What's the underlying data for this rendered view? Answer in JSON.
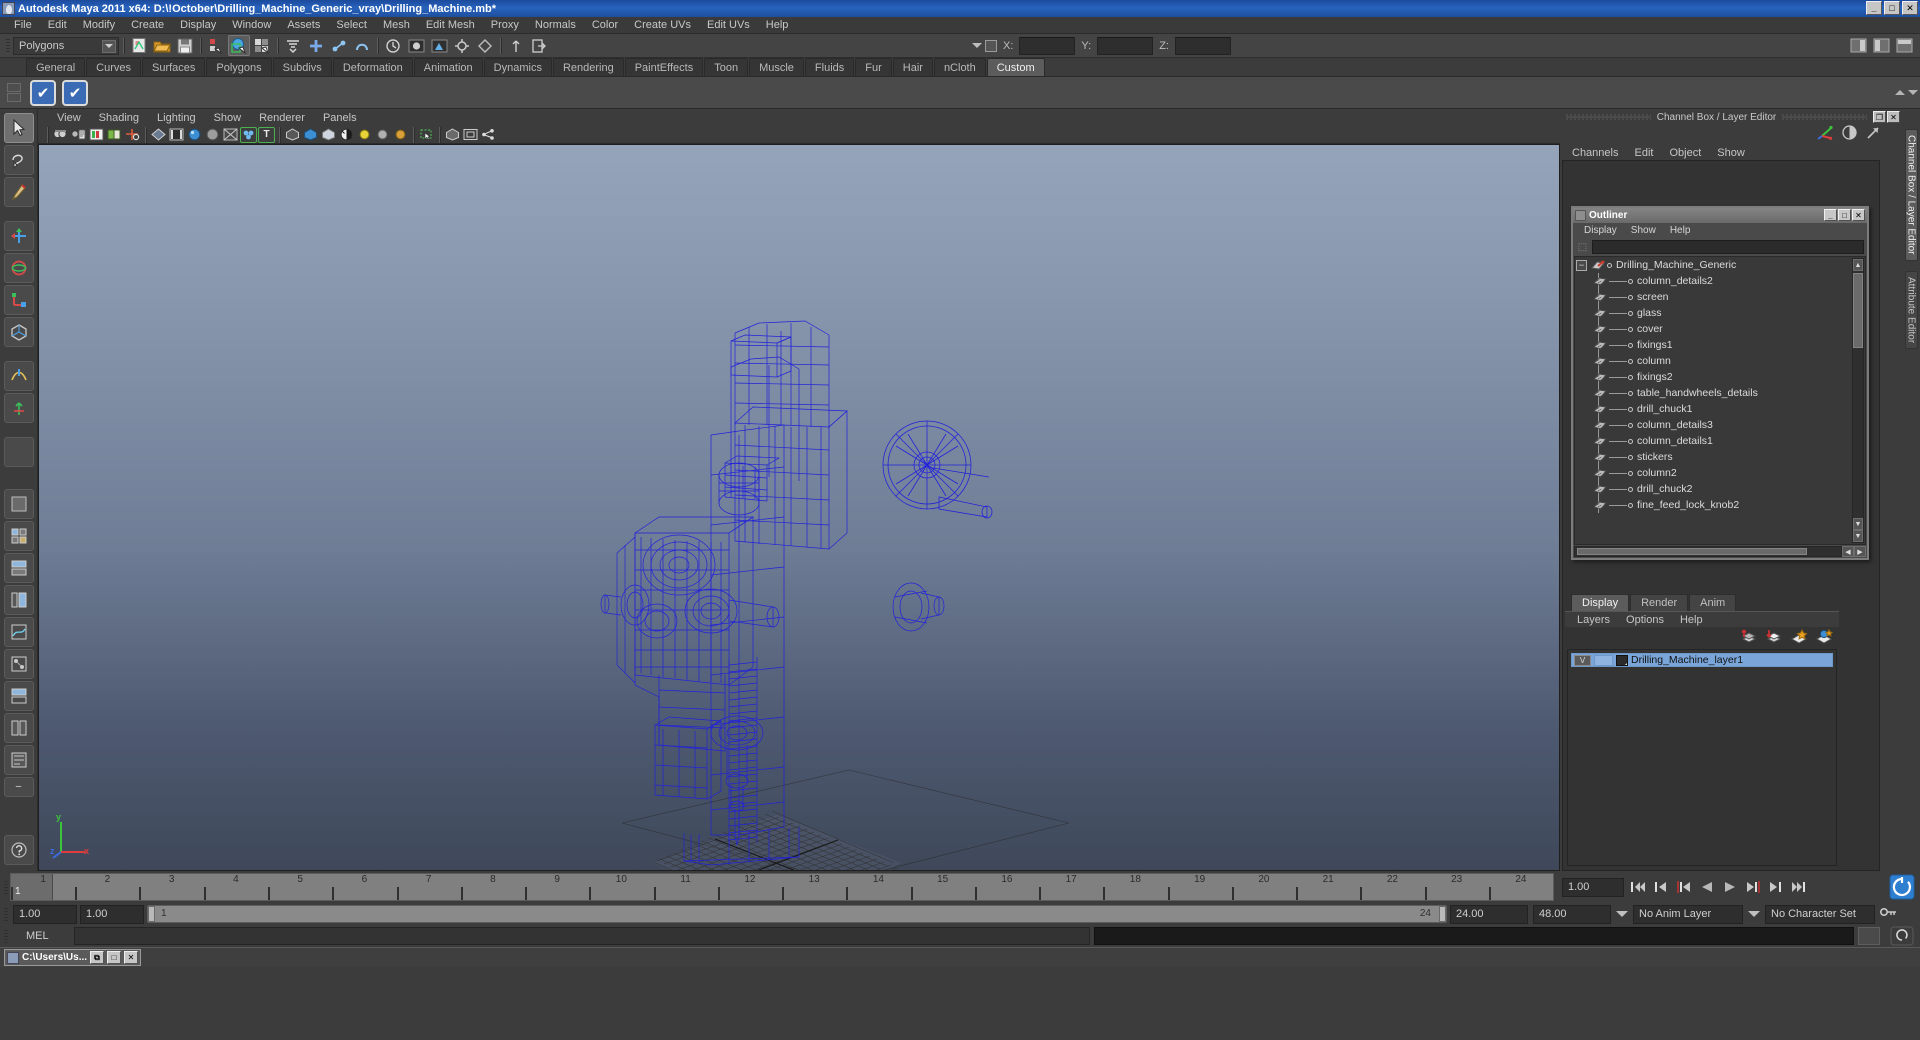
{
  "window": {
    "title": "Autodesk Maya 2011 x64: D:\\!October\\Drilling_Machine_Generic_vray\\Drilling_Machine.mb*",
    "minimize": "_",
    "maximize": "□",
    "close": "✕"
  },
  "menubar": {
    "items": [
      "File",
      "Edit",
      "Modify",
      "Create",
      "Display",
      "Window",
      "Assets",
      "Select",
      "Mesh",
      "Edit Mesh",
      "Proxy",
      "Normals",
      "Color",
      "Create UVs",
      "Edit UVs",
      "Help"
    ]
  },
  "statusline": {
    "mode_selected": "Polygons",
    "axis_labels": {
      "x": "X:",
      "y": "Y:",
      "z": "Z:"
    },
    "x_value": "",
    "y_value": "",
    "z_value": ""
  },
  "shelf": {
    "tabs": [
      "General",
      "Curves",
      "Surfaces",
      "Polygons",
      "Subdivs",
      "Deformation",
      "Animation",
      "Dynamics",
      "Rendering",
      "PaintEffects",
      "Toon",
      "Muscle",
      "Fluids",
      "Fur",
      "Hair",
      "nCloth",
      "Custom"
    ],
    "active_tab": "Custom",
    "icons": [
      "check-blue-icon",
      "check-blue-icon"
    ]
  },
  "viewport": {
    "menus": [
      "View",
      "Shading",
      "Lighting",
      "Show",
      "Renderer",
      "Panels"
    ],
    "axis": {
      "y": "y",
      "x": "x",
      "z": "z"
    },
    "model_name": "Drilling_Machine_Generic",
    "wireframe_color": "#2020d8",
    "background_top": "#96a4bb",
    "background_bottom": "#3e4859"
  },
  "channelbox": {
    "title": "Channel Box / Layer Editor",
    "menus": [
      "Channels",
      "Edit",
      "Object",
      "Show"
    ],
    "restore": "❐",
    "close": "✕"
  },
  "vertical_tabs": [
    {
      "label": "Channel Box / Layer Editor",
      "active": true
    },
    {
      "label": "Attribute Editor",
      "active": false
    }
  ],
  "outliner": {
    "title": "Outliner",
    "menus": [
      "Display",
      "Show",
      "Help"
    ],
    "search_value": "",
    "minimize": "_",
    "maximize": "□",
    "close": "✕",
    "root": {
      "label": "Drilling_Machine_Generic",
      "expander": "−",
      "icon": "transform-icon"
    },
    "children": [
      {
        "label": "column_details2",
        "icon": "mesh-icon"
      },
      {
        "label": "screen",
        "icon": "mesh-icon"
      },
      {
        "label": "glass",
        "icon": "mesh-icon"
      },
      {
        "label": "cover",
        "icon": "mesh-icon"
      },
      {
        "label": "fixings1",
        "icon": "mesh-icon"
      },
      {
        "label": "column",
        "icon": "mesh-icon"
      },
      {
        "label": "fixings2",
        "icon": "mesh-icon"
      },
      {
        "label": "table_handwheels_details",
        "icon": "mesh-icon"
      },
      {
        "label": "drill_chuck1",
        "icon": "mesh-icon"
      },
      {
        "label": "column_details3",
        "icon": "mesh-icon"
      },
      {
        "label": "column_details1",
        "icon": "mesh-icon"
      },
      {
        "label": "stickers",
        "icon": "mesh-icon"
      },
      {
        "label": "column2",
        "icon": "mesh-icon"
      },
      {
        "label": "drill_chuck2",
        "icon": "mesh-icon"
      },
      {
        "label": "fine_feed_lock_knob2",
        "icon": "mesh-icon"
      }
    ]
  },
  "layer_editor": {
    "tabs": [
      "Display",
      "Render",
      "Anim"
    ],
    "active_tab": "Display",
    "menus": [
      "Layers",
      "Options",
      "Help"
    ],
    "buttons": [
      "move-layer-up-icon",
      "move-layer-down-icon",
      "new-layer-icon",
      "new-layer-from-selected-icon"
    ],
    "layers": [
      {
        "visibility": "V",
        "playback": "",
        "swatch": "template",
        "name": "Drilling_Machine_layer1",
        "selected": true
      }
    ]
  },
  "time_slider": {
    "current_frame": "1",
    "start_tick": 1,
    "end_tick": 24,
    "tick_labels": [
      "1",
      "2",
      "3",
      "4",
      "5",
      "6",
      "7",
      "8",
      "9",
      "10",
      "11",
      "12",
      "13",
      "14",
      "15",
      "16",
      "17",
      "18",
      "19",
      "20",
      "21",
      "22",
      "23",
      "24"
    ],
    "frame_field": "1.00",
    "transport": [
      "go-to-start-icon",
      "step-back-key-icon",
      "step-back-frame-icon",
      "play-backwards-icon",
      "play-forwards-icon",
      "step-forward-frame-icon",
      "step-forward-key-icon",
      "go-to-end-icon"
    ]
  },
  "range_slider": {
    "anim_start": "1.00",
    "range_start": "1.00",
    "bar_start_label": "1",
    "bar_end_label": "24",
    "range_end": "24.00",
    "anim_end": "48.00",
    "anim_layer": "No Anim Layer",
    "character_set": "No Character Set"
  },
  "command_line": {
    "language": "MEL",
    "input_value": ""
  },
  "taskbar": {
    "items": [
      {
        "label": "C:\\Users\\Us...",
        "minimize": "⧉",
        "maximize": "□",
        "close": "✕"
      }
    ]
  }
}
